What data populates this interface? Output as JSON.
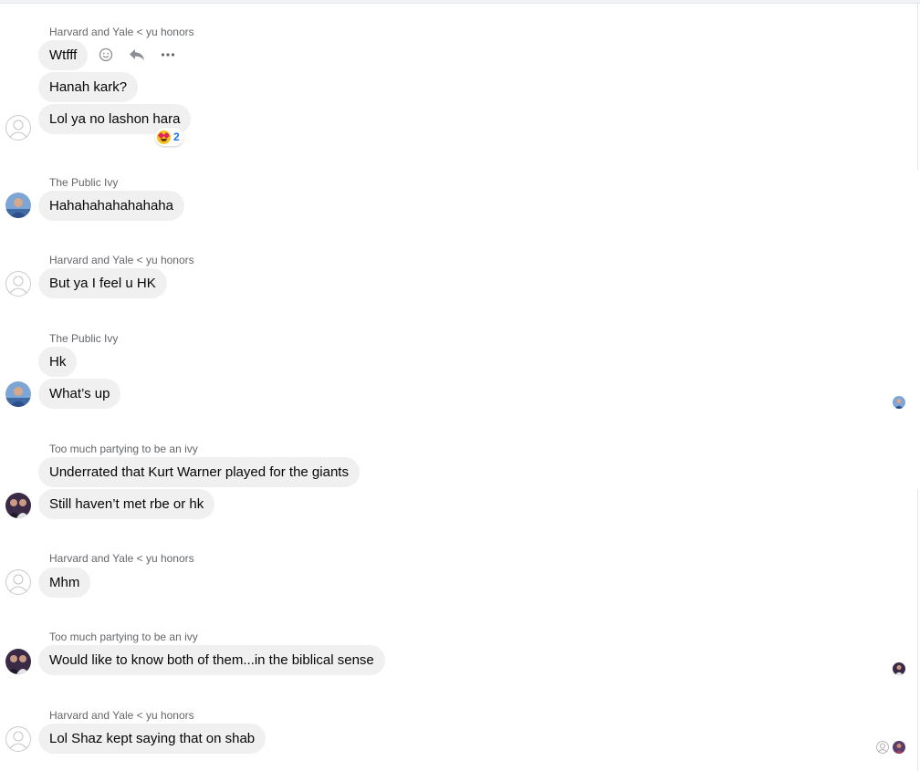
{
  "icons": {
    "react": "emoji-smile-icon",
    "reply": "reply-arrow-icon",
    "more": "more-dots-icon"
  },
  "colors": {
    "bubble": "#f0f0f0",
    "sender_name": "#65676b",
    "reaction_count": "#1877f2"
  },
  "messages": [
    {
      "sender": "Harvard and Yale < yu honors",
      "bubbles": [
        "Wtfff",
        "Hanah kark?",
        "Lol ya no lashon hara"
      ],
      "reaction": {
        "emoji": "😍",
        "count": "2"
      }
    },
    {
      "sender": "The Public Ivy",
      "bubbles": [
        "Hahahahahahahaha"
      ]
    },
    {
      "sender": "Harvard and Yale < yu honors",
      "bubbles": [
        "But ya I feel u HK"
      ]
    },
    {
      "sender": "The Public Ivy",
      "bubbles": [
        "Hk",
        "What’s up"
      ]
    },
    {
      "sender": "Too much partying to be an ivy",
      "bubbles": [
        "Underrated that Kurt Warner played for the giants",
        "Still haven’t met rbe or hk"
      ]
    },
    {
      "sender": "Harvard and Yale < yu honors",
      "bubbles": [
        "Mhm"
      ]
    },
    {
      "sender": "Too much partying to be an ivy",
      "bubbles": [
        "Would like to know both of them...in the biblical sense"
      ]
    },
    {
      "sender": "Harvard and Yale < yu honors",
      "bubbles": [
        "Lol Shaz kept saying that on shab"
      ]
    }
  ]
}
